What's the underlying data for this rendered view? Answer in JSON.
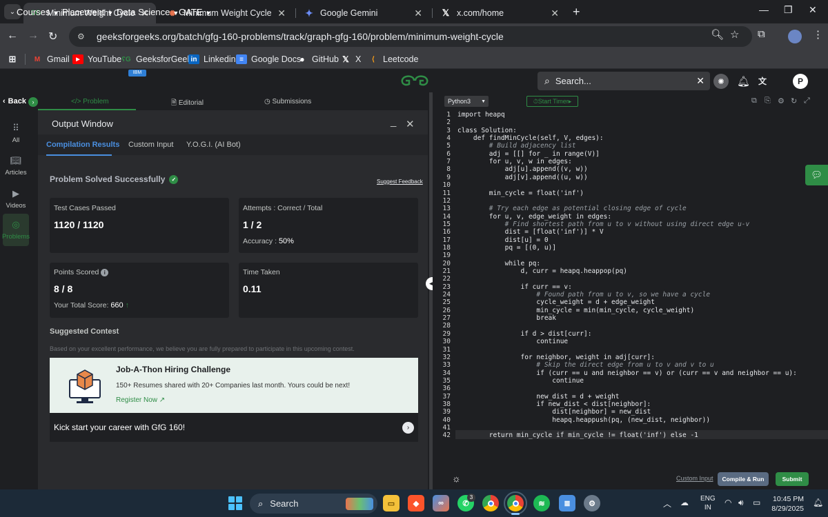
{
  "browser": {
    "tabs": [
      {
        "title": "Minimum Weight Cycle | Practic",
        "active": true
      },
      {
        "title": "Minimum Weight Cycle in Grap",
        "active": false
      },
      {
        "title": "Google Gemini",
        "active": false
      },
      {
        "title": "x.com/home",
        "active": false
      }
    ],
    "url": "geeksforgeeks.org/batch/gfg-160-problems/track/graph-gfg-160/problem/minimum-weight-cycle",
    "bookmarks": [
      "Gmail",
      "YouTube",
      "GeeksforGeeks",
      "Linkedin",
      "Google Docs",
      "GitHub",
      "X",
      "Leetcode"
    ]
  },
  "gfg": {
    "menus": [
      "Courses",
      "Placement",
      "Data Science",
      "GATE"
    ],
    "ibm_badge": "IBM",
    "logo": "ʕG",
    "search_placeholder": "Search...",
    "avatar": "P"
  },
  "sidebar": {
    "back": "Back",
    "items": [
      "All",
      "Articles",
      "Videos",
      "Problems"
    ]
  },
  "problem_tabs": [
    "Problem",
    "Editorial",
    "Submissions"
  ],
  "output": {
    "title": "Output Window",
    "tabs": [
      "Compilation Results",
      "Custom Input",
      "Y.O.G.I. (AI Bot)"
    ],
    "status": "Problem Solved Successfully",
    "feedback": "Suggest Feedback",
    "cards": {
      "tests_label": "Test Cases Passed",
      "tests_value": "1120 / 1120",
      "attempts_label": "Attempts : Correct / Total",
      "attempts_value": "1 / 2",
      "accuracy_label": "Accuracy :",
      "accuracy_value": "50%",
      "points_label": "Points Scored",
      "points_value": "8 / 8",
      "total_label": "Your Total Score:",
      "total_value": "660",
      "time_label": "Time Taken",
      "time_value": "0.11"
    },
    "suggested_title": "Suggested Contest",
    "suggested_desc": "Based on your excellent performance, we believe you are fully prepared to participate in this upcoming contest.",
    "contest_title": "Job-A-Thon Hiring Challenge",
    "contest_desc": "150+ Resumes shared with 20+ Companies last month. Yours could be next!",
    "contest_link": "Register Now ↗",
    "kick": "Kick start your career with GfG 160!"
  },
  "editor": {
    "language": "Python3",
    "timer": "Start Timer",
    "custom_input": "Custom Input",
    "compile": "Compile & Run",
    "submit": "Submit",
    "lines": [
      "import heapq",
      "",
      "class Solution:",
      "    def findMinCycle(self, V, edges):",
      "        # Build adjacency list",
      "        adj = [[] for _ in range(V)]",
      "        for u, v, w in edges:",
      "            adj[u].append((v, w))",
      "            adj[v].append((u, w))",
      "",
      "        min_cycle = float('inf')",
      "",
      "        # Try each edge as potential closing edge of cycle",
      "        for u, v, edge_weight in edges:",
      "            # Find shortest path from u to v without using direct edge u-v",
      "            dist = [float('inf')] * V",
      "            dist[u] = 0",
      "            pq = [(0, u)]",
      "",
      "            while pq:",
      "                d, curr = heapq.heappop(pq)",
      "",
      "                if curr == v:",
      "                    # Found path from u to v, so we have a cycle",
      "                    cycle_weight = d + edge_weight",
      "                    min_cycle = min(min_cycle, cycle_weight)",
      "                    break",
      "",
      "                if d > dist[curr]:",
      "                    continue",
      "",
      "                for neighbor, weight in adj[curr]:",
      "                    # Skip the direct edge from u to v and v to u",
      "                    if (curr == u and neighbor == v) or (curr == v and neighbor == u):",
      "                        continue",
      "",
      "                    new_dist = d + weight",
      "                    if new_dist < dist[neighbor]:",
      "                        dist[neighbor] = new_dist",
      "                        heapq.heappush(pq, (new_dist, neighbor))",
      "",
      "        return min_cycle if min_cycle != float('inf') else -1"
    ]
  },
  "taskbar": {
    "search": "Search",
    "lang_line1": "ENG",
    "lang_line2": "IN",
    "time": "10:45 PM",
    "date": "8/29/2025",
    "whatsapp_badge": "3"
  }
}
